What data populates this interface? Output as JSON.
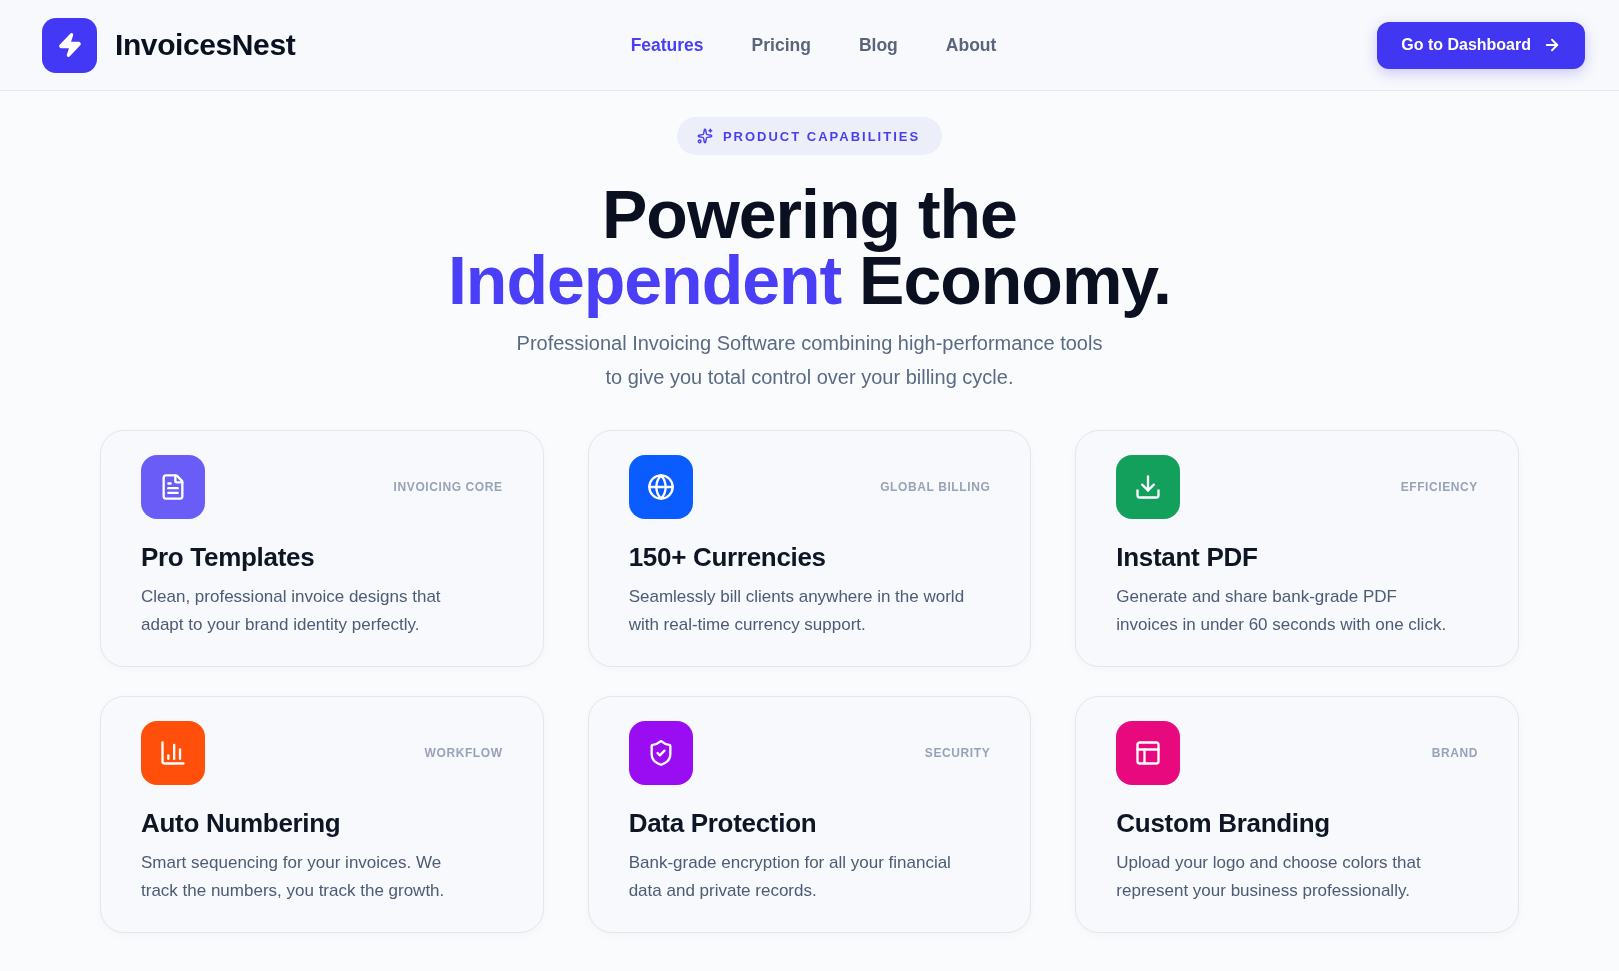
{
  "header": {
    "brand": "InvoicesNest",
    "nav": [
      {
        "label": "Features",
        "selected": true
      },
      {
        "label": "Pricing",
        "selected": false
      },
      {
        "label": "Blog",
        "selected": false
      },
      {
        "label": "About",
        "selected": false
      }
    ],
    "cta": "Go to Dashboard"
  },
  "hero": {
    "badge": "PRODUCT CAPABILITIES",
    "title_lines": [
      {
        "segments": [
          {
            "text": "Powering the",
            "highlight": false
          }
        ]
      },
      {
        "segments": [
          {
            "text": "Independent",
            "highlight": true
          },
          {
            "text": "Economy.",
            "highlight": false
          }
        ]
      }
    ],
    "subtitle": "Professional Invoicing Software combining high-performance tools\nto give you total control over your billing cycle."
  },
  "features": [
    {
      "tag": "INVOICING CORE",
      "title": "Pro Templates",
      "description": "Clean, professional invoice designs that\nadapt to your brand identity perfectly.",
      "color": "#6a5cf6"
    },
    {
      "tag": "GLOBAL BILLING",
      "title": "150+ Currencies",
      "description": "Seamlessly bill clients anywhere in the world\nwith real-time currency support.",
      "color": "#0b5cff"
    },
    {
      "tag": "EFFICIENCY",
      "title": "Instant PDF",
      "description": "Generate and share bank-grade PDF\ninvoices in under 60 seconds with one click.",
      "color": "#12a05c"
    },
    {
      "tag": "WORKFLOW",
      "title": "Auto Numbering",
      "description": "Smart sequencing for your invoices. We\ntrack the numbers, you track the growth.",
      "color": "#ff4f0a"
    },
    {
      "tag": "SECURITY",
      "title": "Data Protection",
      "description": "Bank-grade encryption for all your financial\ndata and private records.",
      "color": "#9a0cf2"
    },
    {
      "tag": "BRAND",
      "title": "Custom Branding",
      "description": "Upload your logo and choose colors that\nrepresent your business professionally.",
      "color": "#e8097f"
    }
  ]
}
